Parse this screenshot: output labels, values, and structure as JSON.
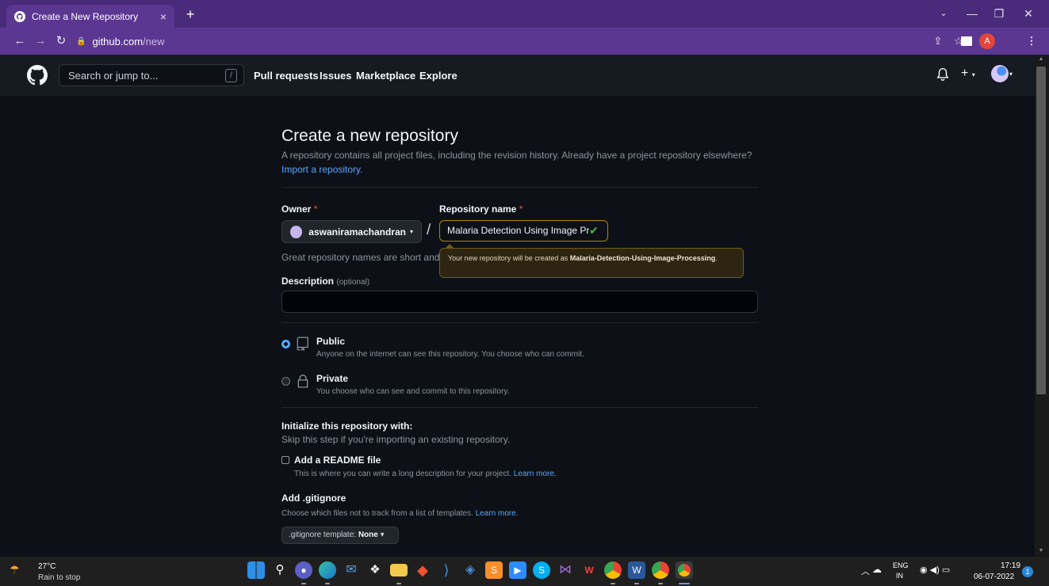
{
  "browser": {
    "tab_title": "Create a New Repository",
    "tab_close": "×",
    "new_tab": "+",
    "url_host": "github.com",
    "url_path": "/new",
    "profile_initial": "A",
    "window_minimize": "—",
    "window_restore": "❐",
    "window_close": "✕",
    "tab_search": "⌄"
  },
  "header": {
    "search_placeholder": "Search or jump to...",
    "search_shortcut": "/",
    "nav": [
      "Pull requests",
      "Issues",
      "Marketplace",
      "Explore"
    ]
  },
  "page": {
    "title": "Create a new repository",
    "subtitle": "A repository contains all project files, including the revision history. Already have a project repository elsewhere?",
    "import_link": "Import a repository.",
    "owner_label": "Owner",
    "owner_value": "aswaniramachandran",
    "repo_label": "Repository name",
    "required_mark": "*",
    "separator": "/",
    "repo_value": "Malaria Detection Using Image Pr",
    "hint_text": "Great repository names are short and",
    "tooltip_prefix": "Your new repository will be created as ",
    "tooltip_name": "Malaria-Detection-Using-Image-Processing",
    "tooltip_suffix": ".",
    "description_label": "Description",
    "description_optional": "(optional)",
    "description_value": "",
    "public_title": "Public",
    "public_desc": "Anyone on the internet can see this repository. You choose who can commit.",
    "private_title": "Private",
    "private_desc": "You choose who can see and commit to this repository.",
    "init_title": "Initialize this repository with:",
    "init_sub": "Skip this step if you're importing an existing repository.",
    "readme_label": "Add a README file",
    "readme_desc": "This is where you can write a long description for your project.",
    "learn_more": "Learn more.",
    "gitignore_title": "Add .gitignore",
    "gitignore_desc": "Choose which files not to track from a list of templates.",
    "gitignore_btn_prefix": ".gitignore template: ",
    "gitignore_btn_value": "None",
    "visibility_selected": "public",
    "readme_checked": false
  },
  "taskbar": {
    "temperature": "27°C",
    "weather": "Rain to stop",
    "lang_top": "ENG",
    "lang_bottom": "IN",
    "time": "17:19",
    "date": "06-07-2022",
    "notifications": "1",
    "apps": [
      "windows-start",
      "search",
      "chat",
      "edge",
      "mail",
      "dropbox",
      "file-explorer",
      "git",
      "vscode",
      "sourcetree",
      "sublime",
      "zoom",
      "skype",
      "visual-studio",
      "wps",
      "chrome-1",
      "word",
      "chrome-2",
      "chrome-3"
    ]
  },
  "colors": {
    "accent": "#58a6ff",
    "required": "#f85149",
    "success": "#3fb950",
    "browser_frame": "#5b3791",
    "page_bg": "#0d1117"
  }
}
